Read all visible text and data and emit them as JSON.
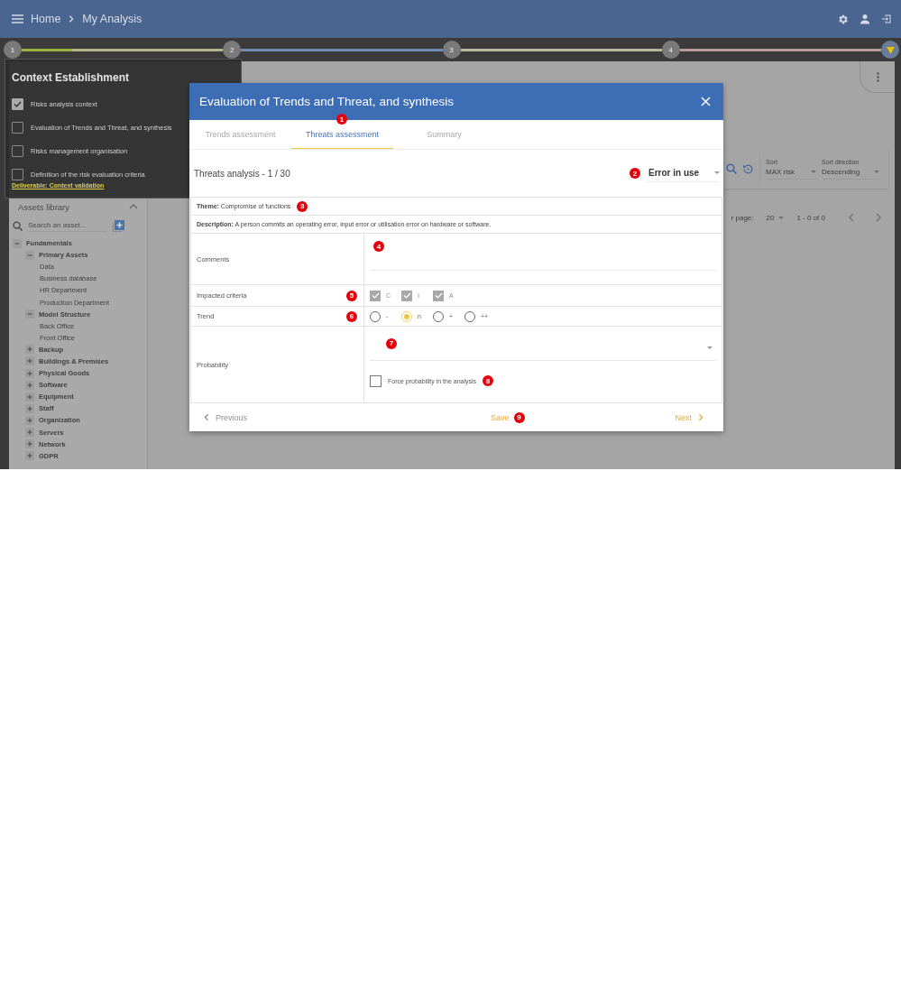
{
  "topbar": {
    "breadcrumb": [
      "Home",
      "My Analysis"
    ]
  },
  "stepper": {
    "steps": [
      {
        "label": "1",
        "color": "#b5b38a",
        "level": 0.25
      },
      {
        "label": "2",
        "color": "#6f8db5"
      },
      {
        "label": "3",
        "color": "#b8b89c"
      },
      {
        "label": "4",
        "color": "#b89c9c"
      }
    ]
  },
  "sidebar": {
    "title": "Assets library",
    "search_placeholder": "Search an asset...",
    "tree": [
      {
        "label": "Fundamentals",
        "expanded": true,
        "children": [
          {
            "label": "Primary Assets",
            "expanded": true,
            "children": [
              {
                "label": "Data"
              },
              {
                "label": "Business database"
              },
              {
                "label": "HR Department"
              },
              {
                "label": "Production Department"
              }
            ]
          },
          {
            "label": "Model Structure",
            "expanded": true,
            "children": [
              {
                "label": "Back Office"
              },
              {
                "label": "Front Office"
              }
            ]
          },
          {
            "label": "Backup",
            "expanded": false
          },
          {
            "label": "Buildings & Premises",
            "expanded": false
          },
          {
            "label": "Physical Goods",
            "expanded": false
          },
          {
            "label": "Software",
            "expanded": false
          },
          {
            "label": "Equipment",
            "expanded": false
          },
          {
            "label": "Staff",
            "expanded": false
          },
          {
            "label": "Organization",
            "expanded": false
          },
          {
            "label": "Servers",
            "expanded": false
          },
          {
            "label": "Network",
            "expanded": false
          },
          {
            "label": "GDPR",
            "expanded": false
          }
        ]
      }
    ]
  },
  "main": {
    "sort": {
      "label": "Sort",
      "value": "MAX risk"
    },
    "sort_direction": {
      "label": "Sort direction",
      "value": "Descending"
    },
    "pagination": {
      "items_per_page_label": "r page:",
      "page_size": "20",
      "range": "1 - 0 of 0"
    }
  },
  "context_popup": {
    "title": "Context Establishment",
    "items": [
      {
        "label": "Risks analysis context",
        "checked": true
      },
      {
        "label": "Evaluation of Trends and Threat, and synthesis",
        "checked": false
      },
      {
        "label": "Risks management organisation",
        "checked": false
      },
      {
        "label": "Definition of the risk evaluation criteria",
        "checked": false
      }
    ],
    "deliverable": "Deliverable: Context validation"
  },
  "dialog": {
    "title": "Evaluation of Trends and Threat, and synthesis",
    "tabs": [
      {
        "label": "Trends assessment",
        "selected": false
      },
      {
        "label": "Threats assessment",
        "selected": true,
        "marker": "1"
      },
      {
        "label": "Summary",
        "selected": false
      }
    ],
    "threat_counter": "Threats analysis - 1 / 30",
    "threat_select": {
      "value": "Error in use",
      "marker": "2"
    },
    "theme": {
      "text": "**Theme:** Compromise of functions",
      "marker": "3"
    },
    "description": {
      "text": "**Description:** A person commits an operating error, input error or utilisation error on hardware or software."
    },
    "comments": {
      "label": "Comments",
      "marker": "4"
    },
    "impacted_criteria": {
      "label": "Impacted criteria",
      "marker": "5",
      "options": [
        {
          "label": "C",
          "checked": true,
          "disabled": true
        },
        {
          "label": "I",
          "checked": true,
          "disabled": true
        },
        {
          "label": "A",
          "checked": true,
          "disabled": true
        }
      ]
    },
    "trend": {
      "label": "Trend",
      "marker": "6",
      "options": [
        {
          "label": "-",
          "selected": false
        },
        {
          "label": "n",
          "selected": true
        },
        {
          "label": "+",
          "selected": false
        },
        {
          "label": "++",
          "selected": false
        }
      ]
    },
    "probability": {
      "label": "Probability",
      "marker": "7"
    },
    "force_probability": {
      "label": "Force probability in the analysis",
      "checked": false,
      "marker": "8"
    },
    "footer": {
      "previous": {
        "label": "Previous",
        "disabled": true
      },
      "save": {
        "label": "Save",
        "marker": "9"
      },
      "next": {
        "label": "Next",
        "disabled": false
      }
    }
  }
}
